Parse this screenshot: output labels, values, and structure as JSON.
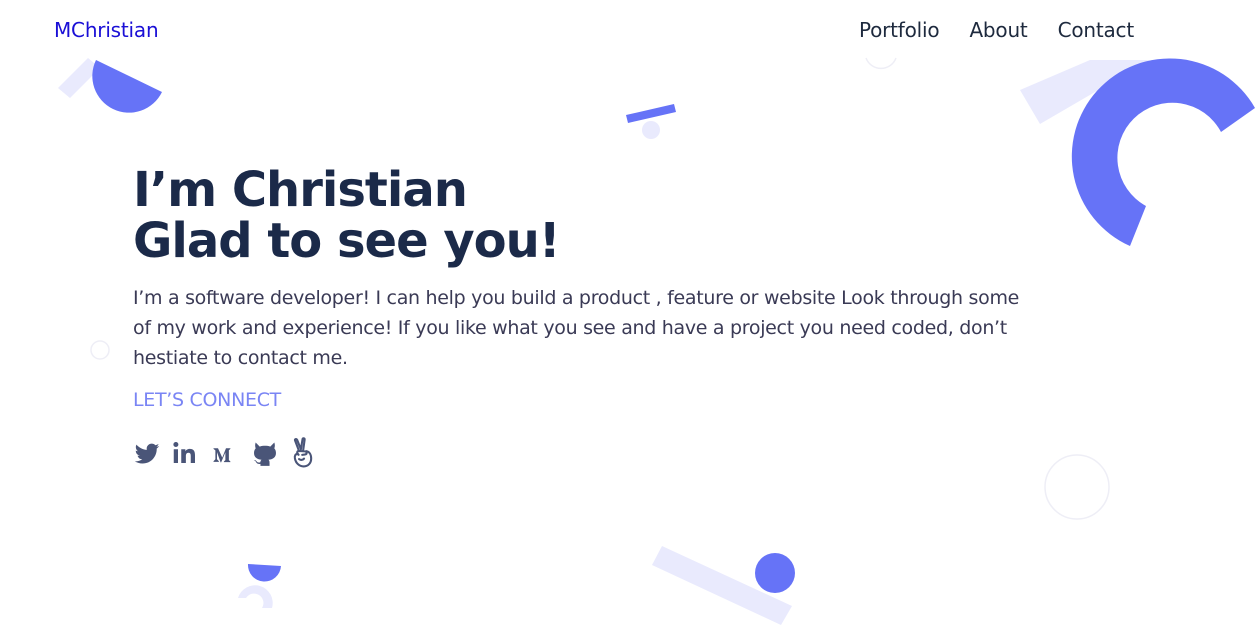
{
  "nav": {
    "brand": "MChristian",
    "links": [
      {
        "label": "Portfolio"
      },
      {
        "label": "About"
      },
      {
        "label": "Contact"
      }
    ]
  },
  "hero": {
    "title_line1": "I’m Christian",
    "title_line2": "Glad to see you!",
    "description": "I’m a software developer! I can help you build a product , feature or website Look through some of my work and experience! If you like what you see and have a project you need coded, don’t hestiate to contact me.",
    "cta_label": "LET’S CONNECT"
  },
  "socials": [
    {
      "name": "twitter-icon"
    },
    {
      "name": "linkedin-icon"
    },
    {
      "name": "medium-icon"
    },
    {
      "name": "github-icon"
    },
    {
      "name": "angellist-icon"
    }
  ],
  "colors": {
    "accent": "#6673f7",
    "accent_light": "#e9eafd",
    "brand": "#1a0fd6",
    "heading": "#1b2a49",
    "body_text": "#3a3a55",
    "cta": "#7a85f4",
    "icon": "#4a5578"
  }
}
